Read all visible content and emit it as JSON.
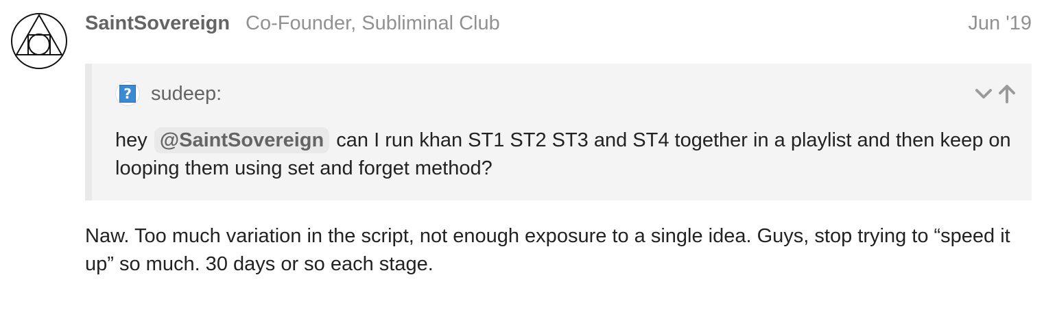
{
  "post": {
    "username": "SaintSovereign",
    "user_title": "Co-Founder, Subliminal Club",
    "date": "Jun '19",
    "avatar_icon": "triangle-circle-emblem-icon"
  },
  "quote": {
    "author": "sudeep:",
    "avatar_icon": "question-mark-avatar-icon",
    "avatar_glyph": "?",
    "text_before": "hey",
    "mention": "@SaintSovereign",
    "text_after": "can I run khan ST1 ST2 ST3 and ST4 together in a playlist and then keep on looping them using set and forget method?",
    "controls": {
      "expand_icon": "chevron-down-icon",
      "jump_icon": "arrow-up-icon"
    }
  },
  "reply": {
    "text": "Naw. Too much variation in the script, not enough exposure to a single idea. Guys, stop trying to “speed it up” so much. 30 days or so each stage."
  },
  "colors": {
    "username": "#646464",
    "secondary": "#919191",
    "quote_bg": "#f4f4f4",
    "quote_border": "#e9e9e9",
    "mention_bg": "#e9e9e9",
    "body_text": "#222222"
  }
}
